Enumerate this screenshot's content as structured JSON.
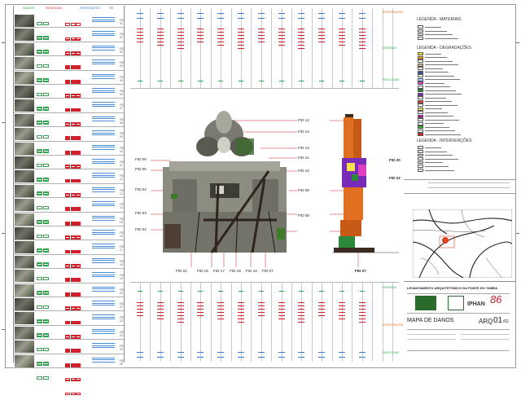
{
  "left_table": {
    "headers": [
      "IMAGENS",
      "PATOLOGIAS",
      "INTERVENÇÕES",
      "FID"
    ],
    "rows": [
      {
        "fid": "FID 01"
      },
      {
        "fid": "FID 02"
      },
      {
        "fid": "FID 03"
      },
      {
        "fid": "FID 04"
      },
      {
        "fid": "FID 05"
      },
      {
        "fid": "FID 06"
      },
      {
        "fid": "FID 07"
      },
      {
        "fid": "FID 08"
      },
      {
        "fid": "FID 09"
      },
      {
        "fid": "FID 10"
      },
      {
        "fid": "FID 11"
      },
      {
        "fid": "FID 12"
      },
      {
        "fid": "FID 13"
      },
      {
        "fid": "FID 14"
      },
      {
        "fid": "FID 15"
      },
      {
        "fid": "FID 16"
      },
      {
        "fid": "FID 17"
      },
      {
        "fid": "FID 18"
      },
      {
        "fid": "FID 19"
      },
      {
        "fid": "FID 20"
      },
      {
        "fid": "FID 21"
      },
      {
        "fid": "FID 22"
      },
      {
        "fid": "FID 23"
      },
      {
        "fid": "FID 24"
      },
      {
        "fid": "FID 25"
      }
    ]
  },
  "top_grid": {
    "column_fids": [
      "FID 01",
      "FID 02",
      "FID 03",
      "FID 04",
      "FID 05",
      "FID 06",
      "FID 07",
      "FID 08",
      "FID 09",
      "FID 10",
      "FID 11",
      "FID 12",
      "FID 13"
    ],
    "label_top_right": "INTERVENÇÕES",
    "label_right_mid": "MATERIAIS",
    "label_right_bottom": "PATOLOGIAS"
  },
  "bottom_grid": {
    "label_top_right": "INTERVENÇÕES",
    "label_right_mid": "MATERIAIS",
    "label_right_bottom": "PATOLOGIAS"
  },
  "drawing": {
    "left_labels": [
      "FID 06",
      "FID 05",
      "FID 04",
      "FID 03",
      "FID 02"
    ],
    "right_labels": [
      "FID 13",
      "FID 14",
      "FID 12",
      "FID 11",
      "FID 10",
      "FID 09",
      "FID 08"
    ],
    "bottom_labels": [
      "FID 01",
      "FID 16",
      "FID 17",
      "FID 18",
      "FID 19",
      "FID 07"
    ],
    "section_labels": [
      "FID 20",
      "FID 22",
      "FID 07"
    ]
  },
  "legend": {
    "title_materials": "LEGENDA - MATERIAIS",
    "title_degradations": "LEGENDA - DEGRADAÇÕES",
    "title_interventions": "LEGENDA - INTERVENÇÕES",
    "materials": [
      {
        "color": "#ffffff"
      },
      {
        "color": "#dddddd"
      },
      {
        "color": "#ffffff"
      },
      {
        "color": "#ffffff"
      }
    ],
    "degradations": [
      {
        "color": "#f4e04d"
      },
      {
        "color": "#f0a020"
      },
      {
        "color": "#ffffff"
      },
      {
        "color": "#c9b49a"
      },
      {
        "color": "#ffffff"
      },
      {
        "color": "#3b4fa8"
      },
      {
        "color": "#ffffff"
      },
      {
        "color": "#a8d0f0"
      },
      {
        "color": "#e040c0"
      },
      {
        "color": "#ffffff"
      },
      {
        "color": "#2a8a3a"
      },
      {
        "color": "#7a2ab8"
      },
      {
        "color": "#ffffff"
      },
      {
        "color": "#e84040"
      },
      {
        "color": "#ffffff"
      },
      {
        "color": "#f0e070"
      },
      {
        "color": "#ffffff"
      },
      {
        "color": "#b02090"
      },
      {
        "color": "#ffffff"
      },
      {
        "color": "#ffffff"
      },
      {
        "color": "#40b040"
      },
      {
        "color": "#ffffff"
      },
      {
        "color": "#d82020"
      }
    ],
    "interventions_count": 7
  },
  "title_block": {
    "project": "LEVANTAMENTO ARQUITETÔNICO DA FONTE DO TAMBÁ",
    "sheet_title": "MAPA DE DANOS",
    "sheet_code": "ARQ",
    "sheet_number": "01",
    "sheet_total": "/02",
    "logo_text": "IPHAN"
  },
  "colors": {
    "red": "#d0202a",
    "green": "#29a84a",
    "blue": "#3a7bd0",
    "section_orange": "#e07020",
    "section_green": "#2a8a3a",
    "section_purple": "#7a2ab8",
    "photo_stone": "#8c8c80"
  }
}
